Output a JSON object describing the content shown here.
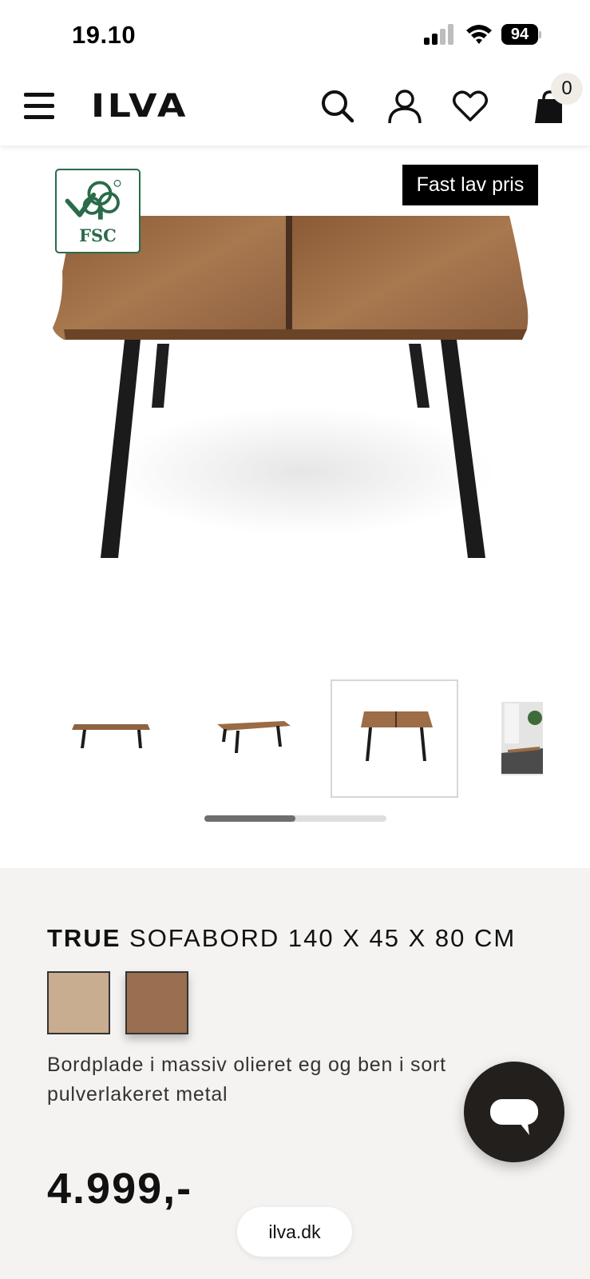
{
  "status_bar": {
    "time": "19.10",
    "battery": "94"
  },
  "header": {
    "logo": "ILVA",
    "cart_count": "0",
    "icons": [
      "menu-icon",
      "search-icon",
      "user-icon",
      "heart-icon",
      "bag-icon"
    ]
  },
  "product_image": {
    "badge_fsc": "FSC",
    "price_tag": "Fast lav pris"
  },
  "thumbnails": {
    "count": 4,
    "active_index": 2
  },
  "product": {
    "brand": "TRUE",
    "name": "SOFABORD 140 X 45 X 80 CM",
    "swatches": [
      {
        "color": "#c8ad90"
      },
      {
        "color": "#9a6e50"
      }
    ],
    "description": "Bordplade i massiv olieret eg og ben i sort pulverlakeret metal",
    "price": "4.999,-"
  },
  "browser": {
    "url": "ilva.dk"
  },
  "colors": {
    "panel_bg": "#f4f3f1",
    "chat_bg": "#231f1d",
    "fsc_green": "#2a6b4a",
    "wood": "#8a5f3c"
  }
}
